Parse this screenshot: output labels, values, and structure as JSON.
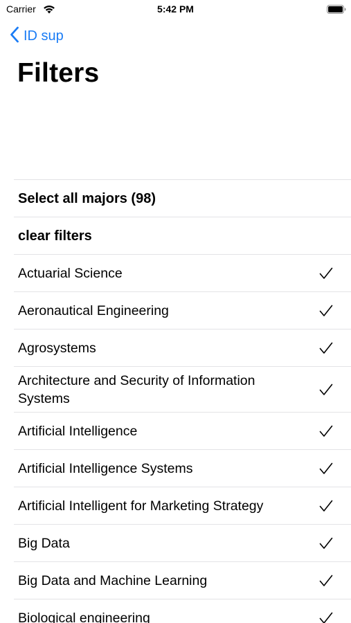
{
  "status_bar": {
    "carrier": "Carrier",
    "time": "5:42 PM"
  },
  "nav": {
    "back_label": "ID sup",
    "title": "Filters"
  },
  "actions": {
    "select_all": "Select all majors (98)",
    "clear_filters": "clear filters"
  },
  "majors": [
    {
      "label": "Actuarial Science",
      "checked": true
    },
    {
      "label": "Aeronautical Engineering",
      "checked": true
    },
    {
      "label": "Agrosystems",
      "checked": true
    },
    {
      "label": "Architecture and Security of Information Systems",
      "checked": true
    },
    {
      "label": "Artificial Intelligence",
      "checked": true
    },
    {
      "label": "Artificial Intelligence Systems",
      "checked": true
    },
    {
      "label": "Artificial Intelligent for Marketing Strategy",
      "checked": true
    },
    {
      "label": "Big Data",
      "checked": true
    },
    {
      "label": "Big Data and Machine Learning",
      "checked": true
    },
    {
      "label": "Biological engineering",
      "checked": true
    }
  ],
  "colors": {
    "accent": "#1a7cf5",
    "separator": "#e3e3e6"
  }
}
